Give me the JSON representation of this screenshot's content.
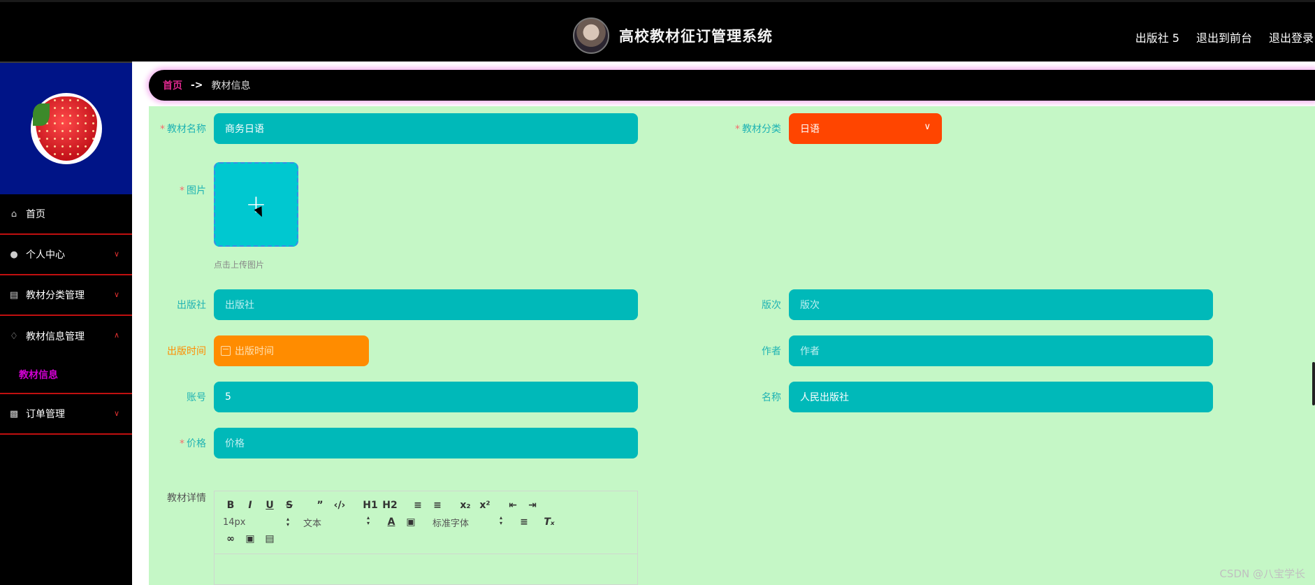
{
  "header": {
    "title": "高校教材征订管理系统",
    "links": [
      "出版社 5",
      "退出到前台",
      "退出登录"
    ]
  },
  "sidebar": {
    "items": [
      {
        "label": "首页",
        "icon": "home-icon"
      },
      {
        "label": "个人中心",
        "icon": "user-icon"
      },
      {
        "label": "教材分类管理",
        "icon": "category-icon"
      },
      {
        "label": "教材信息管理",
        "icon": "bell-icon",
        "sub": "教材信息"
      },
      {
        "label": "订单管理",
        "icon": "order-icon"
      }
    ]
  },
  "breadcrumb": {
    "home": "首页",
    "sep": "->",
    "current": "教材信息"
  },
  "form": {
    "name_label": "教材名称",
    "name_value": "商务日语",
    "category_label": "教材分类",
    "category_value": "日语",
    "image_label": "图片",
    "upload_hint": "点击上传图片",
    "publisher_label": "出版社",
    "publisher_placeholder": "出版社",
    "edition_label": "版次",
    "edition_placeholder": "版次",
    "pubdate_label": "出版时间",
    "pubdate_placeholder": "出版时间",
    "author_label": "作者",
    "author_placeholder": "作者",
    "account_label": "账号",
    "account_value": "5",
    "pname_label": "名称",
    "pname_value": "人民出版社",
    "price_label": "价格",
    "price_placeholder": "价格",
    "detail_label": "教材详情"
  },
  "editor": {
    "font_size": "14px",
    "text_style": "文本",
    "font_family": "标准字体"
  },
  "watermark": "CSDN @八宝学长",
  "colors": {
    "accent": "#00b9b9",
    "category_select": "#ff4500",
    "date": "#ff8c00",
    "panel": "#c5f7c6",
    "sidebar_profile": "#001487"
  }
}
